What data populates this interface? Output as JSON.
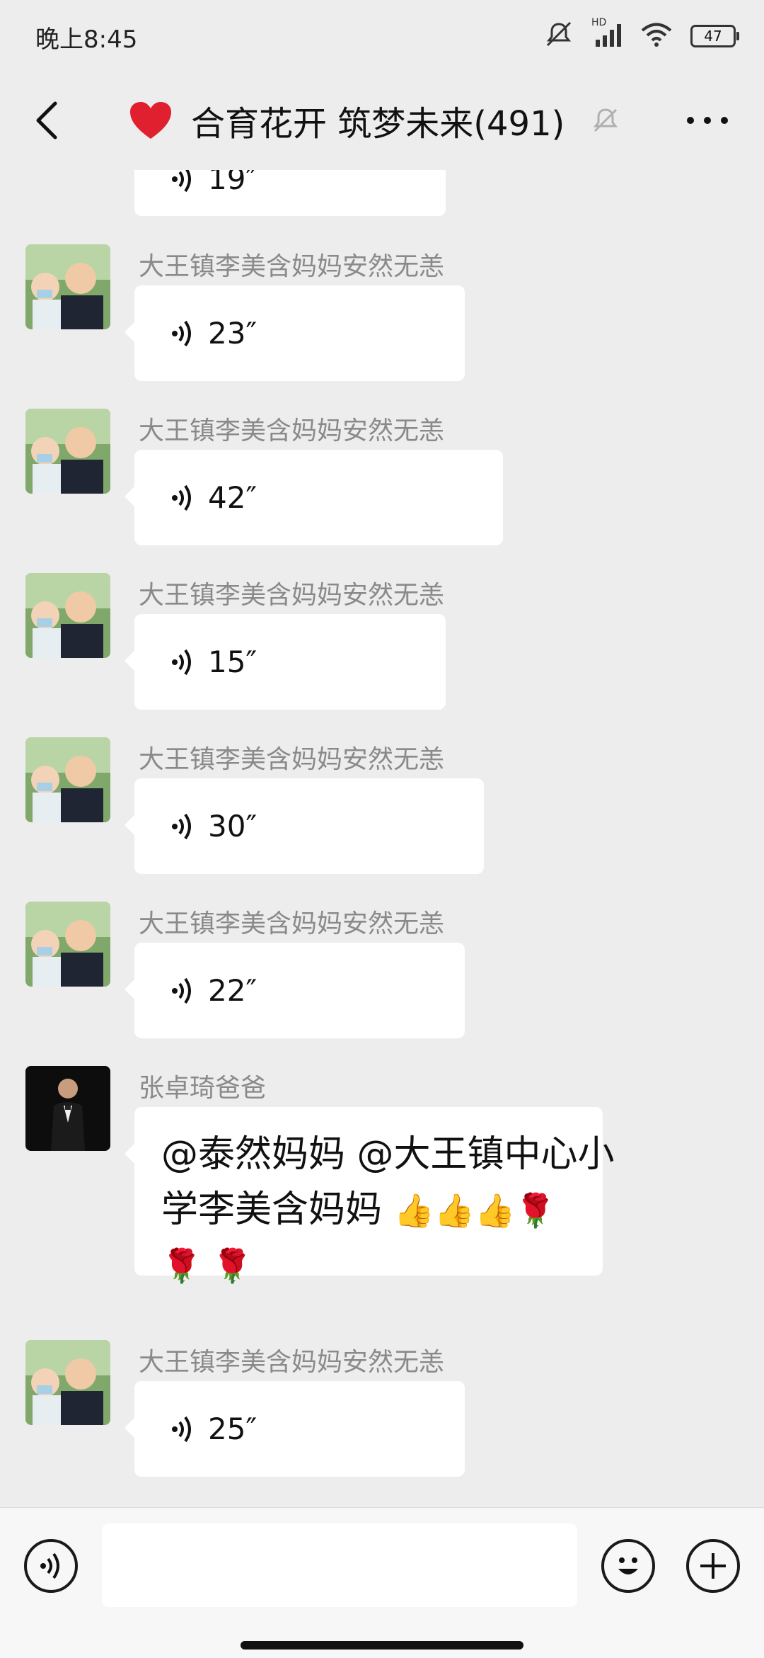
{
  "status_bar": {
    "time": "晚上8:45",
    "battery": "47",
    "hd_label": "HD"
  },
  "header": {
    "title": "合育花开 筑梦未来(491)",
    "icons": [
      "back-icon",
      "heart-icon",
      "mute-bell-icon",
      "more-icon"
    ]
  },
  "partial_top": {
    "duration": "19″"
  },
  "messages": [
    {
      "sender": "大王镇李美含妈妈安然无恙",
      "type": "voice",
      "duration": "23″"
    },
    {
      "sender": "大王镇李美含妈妈安然无恙",
      "type": "voice",
      "duration": "42″"
    },
    {
      "sender": "大王镇李美含妈妈安然无恙",
      "type": "voice",
      "duration": "15″"
    },
    {
      "sender": "大王镇李美含妈妈安然无恙",
      "type": "voice",
      "duration": "30″"
    },
    {
      "sender": "大王镇李美含妈妈安然无恙",
      "type": "voice",
      "duration": "22″"
    },
    {
      "sender": "张卓琦爸爸",
      "type": "text",
      "line1": "@泰然妈妈 @大王镇中心小",
      "line2": "学李美含妈妈 ",
      "emojis_line2": "👍👍👍🌹",
      "line3": "🌹 🌹"
    },
    {
      "sender": "大王镇李美含妈妈安然无恙",
      "type": "voice",
      "duration": "25″"
    }
  ],
  "input_bar": {
    "placeholder": "",
    "icons": [
      "voice-input-icon",
      "emoji-icon",
      "plus-icon"
    ]
  },
  "colors": {
    "background": "#ededed",
    "bubble": "#ffffff",
    "sender": "#8a8a8a"
  }
}
